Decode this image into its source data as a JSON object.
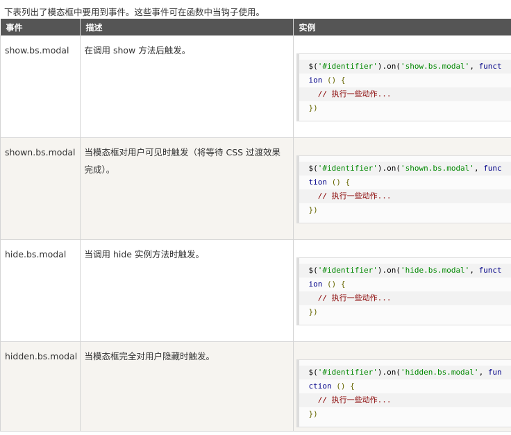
{
  "intro": "下表列出了模态框中要用到事件。这些事件可在函数中当钩子使用。",
  "headers": {
    "event": "事件",
    "desc": "描述",
    "example": "实例"
  },
  "rows": [
    {
      "event": "show.bs.modal",
      "desc": "在调用 show 方法后触发。",
      "code": {
        "prefix": "$(",
        "id": "'#identifier'",
        "mid": ").on(",
        "name": "'show.bs.modal'",
        "comma": ", ",
        "fn1": "funct",
        "fn2": "ion",
        "parens": " () {",
        "comment": "  // 执行一些动作...",
        "close": "})"
      }
    },
    {
      "event": "shown.bs.modal",
      "desc": "当模态框对用户可见时触发（将等待 CSS 过渡效果完成）。",
      "code": {
        "prefix": "$(",
        "id": "'#identifier'",
        "mid": ").on(",
        "name": "'shown.bs.modal'",
        "comma": ", ",
        "fn1": "func",
        "fn2": "tion",
        "parens": " () {",
        "comment": "  // 执行一些动作...",
        "close": "})"
      }
    },
    {
      "event": "hide.bs.modal",
      "desc": "当调用 hide 实例方法时触发。",
      "code": {
        "prefix": "$(",
        "id": "'#identifier'",
        "mid": ").on(",
        "name": "'hide.bs.modal'",
        "comma": ", ",
        "fn1": "funct",
        "fn2": "ion",
        "parens": " () {",
        "comment": "  // 执行一些动作...",
        "close": "})"
      }
    },
    {
      "event": "hidden.bs.modal",
      "desc": "当模态框完全对用户隐藏时触发。",
      "code": {
        "prefix": "$(",
        "id": "'#identifier'",
        "mid": ").on(",
        "name": "'hidden.bs.modal'",
        "comma": ", ",
        "fn1": "fun",
        "fn2": "ction",
        "parens": " () {",
        "comment": "  // 执行一些动作...",
        "close": "})"
      }
    }
  ]
}
